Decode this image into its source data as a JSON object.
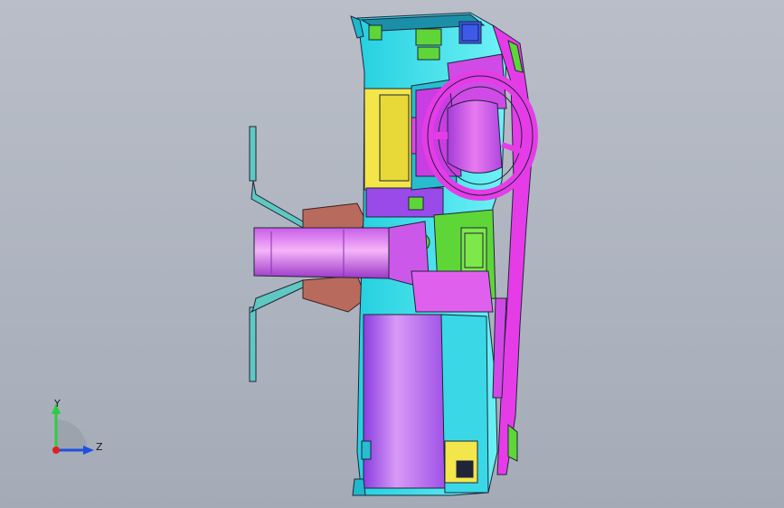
{
  "viewport": {
    "background_top": "#b9bec8",
    "background_bottom": "#a4abb7"
  },
  "model": {
    "colors": {
      "cyan": "#33e6f0",
      "magenta": "#e63ce8",
      "purple": "#b06ef0",
      "yellow": "#f2e64a",
      "green": "#5ed638",
      "lime": "#7de84a",
      "brown": "#b86a5c",
      "pink": "#f070d8",
      "teal": "#5fc8c0",
      "outline": "#20243a"
    }
  },
  "triad": {
    "y_label": "Y",
    "z_label": "Z",
    "y_color": "#2ecc40",
    "z_color": "#1f4fe0",
    "x_color": "#e02020"
  }
}
